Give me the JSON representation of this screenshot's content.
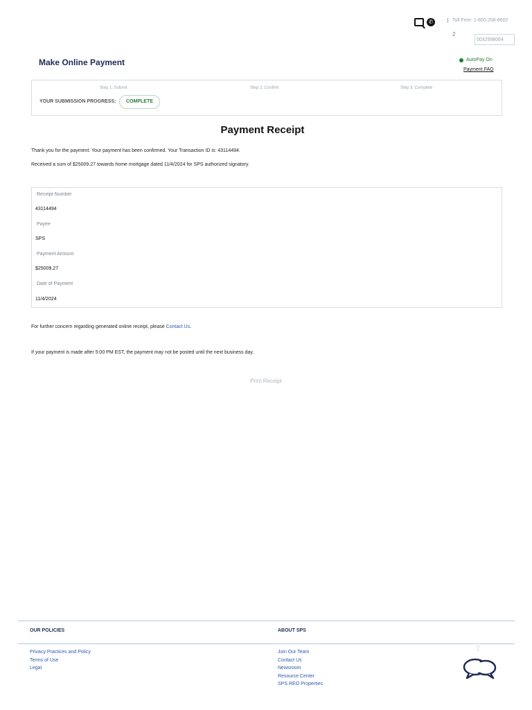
{
  "header": {
    "toll_free": "Toll Free: 1-800-258-8602",
    "badge_number": "2",
    "account_number": "0032998064",
    "icons": [
      "search-icon",
      "phone-icon"
    ]
  },
  "page": {
    "title": "Make Online Payment",
    "autopay_status": "AutoPay On",
    "payment_faq": "Payment FAQ"
  },
  "progress": {
    "steps": [
      "Step 1: Submit",
      "Step 2: Confirm",
      "Step 3: Complete"
    ],
    "label": "YOUR SUBMISSION PROGRESS:",
    "status": "COMPLETE"
  },
  "receipt": {
    "title": "Payment Receipt",
    "confirmation": "Thank you for the payment. Your payment has been confirmed. Your Transaction ID is: 43114494.",
    "summary": "Received a sum of $25009.27 towards home mortgage dated 11/4/2024 for SPS authorized signatory.",
    "fields": [
      {
        "label": "Receipt Number",
        "value": "43114494"
      },
      {
        "label": "Payee",
        "value": "SPS"
      },
      {
        "label": "Payment Amount",
        "value": "$25009.27"
      },
      {
        "label": "Date of Payment",
        "value": "11/4/2024"
      }
    ],
    "concern_prefix": "For further concern regarding generated online receipt, please",
    "contact_link": "Contact Us",
    "concern_suffix": ".",
    "cutoff_note": "If your payment is made after 5:00 PM EST, the payment may not be posted until the next business day.",
    "print_label": "Print Receipt"
  },
  "footer": {
    "policies_heading": "OUR POLICIES",
    "policies_links": [
      "Privacy Practices and Policy",
      "Terms of Use",
      "Legal"
    ],
    "about_heading": "ABOUT SPS",
    "about_links": [
      "Join Our Team",
      "Contact Us",
      "Newsroom",
      "Resource Center",
      "SPS REO Properties"
    ]
  },
  "colors": {
    "brand_navy": "#1f2a55",
    "link_blue": "#2f56b0",
    "success_green": "#1e7d32",
    "border_gray": "#d6dbe0"
  }
}
